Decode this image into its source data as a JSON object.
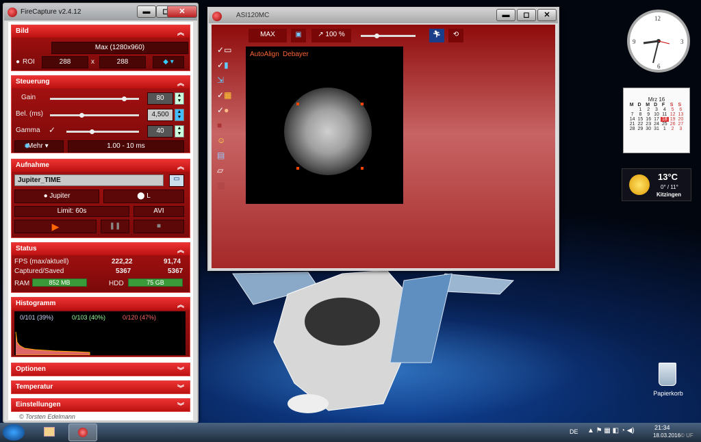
{
  "app_title": "FireCapture v2.4.12",
  "window_buttons": {
    "minimize": "▬",
    "maximize": "◻",
    "close": "✕"
  },
  "bild": {
    "header": "Bild",
    "max_label": "Max (1280x960)",
    "roi_label": "ROI",
    "roi_w": "288",
    "roi_x": "x",
    "roi_h": "288"
  },
  "steuerung": {
    "header": "Steuerung",
    "gain_label": "Gain",
    "gain_value": "80",
    "gain_level": 0.83,
    "bel_label": "Bel. (ms)",
    "bel_value": "4,500",
    "bel_level": 0.35,
    "gamma_label": "Gamma",
    "gamma_value": "40",
    "gamma_level": 0.35,
    "mehr_label": "Mehr",
    "range_label": "1.00 - 10 ms"
  },
  "aufnahme": {
    "header": "Aufnahme",
    "name": "Jupiter_TIME",
    "jupiter_btn": "Jupiter",
    "l_btn": "L",
    "limit_btn": "Limit: 60s",
    "avi_btn": "AVI"
  },
  "status": {
    "header": "Status",
    "fps_label": "FPS (max/aktuell)",
    "fps_max": "222,22",
    "fps_cur": "91,74",
    "cap_label": "Captured/Saved",
    "captured": "5367",
    "saved": "5367",
    "ram_label": "RAM",
    "ram_value": "852 MB",
    "hdd_label": "HDD",
    "hdd_value": "75 GB"
  },
  "histogramm": {
    "header": "Histogramm",
    "v1": "0/101 (39%)",
    "v2": "0/103 (40%)",
    "v3": "0/120 (47%)"
  },
  "collapsed": {
    "optionen": "Optionen",
    "temperatur": "Temperatur",
    "einstellungen": "Einstellungen"
  },
  "credit": "© Torsten Edelmann",
  "capture": {
    "title": "ASI120MC",
    "max_btn": "MAX",
    "zoom": "100 %",
    "autoalign": "AutoAlign",
    "debayer": "Debayer"
  },
  "calendar": {
    "month": "Mrz 16",
    "days": [
      "M",
      "D",
      "M",
      "D",
      "F",
      "S",
      "S"
    ],
    "weeks": [
      [
        "",
        "1",
        "2",
        "3",
        "4",
        "5",
        "6"
      ],
      [
        "7",
        "8",
        "9",
        "10",
        "11",
        "12",
        "13"
      ],
      [
        "14",
        "15",
        "16",
        "17",
        "18",
        "19",
        "20"
      ],
      [
        "21",
        "22",
        "23",
        "24",
        "25",
        "26",
        "27"
      ],
      [
        "28",
        "29",
        "30",
        "31",
        "1",
        "2",
        "3"
      ]
    ],
    "today": "18"
  },
  "weather": {
    "temp": "13°C",
    "range": "0° / 11°",
    "city": "Kitzingen"
  },
  "desktop": {
    "recycle": "Papierkorb"
  },
  "taskbar": {
    "lang": "DE",
    "time": "21:34",
    "date": "18.03.2016",
    "watermark": "© UF"
  },
  "colors": {
    "accent": "#c21515",
    "panel": "#8a0c0c"
  }
}
